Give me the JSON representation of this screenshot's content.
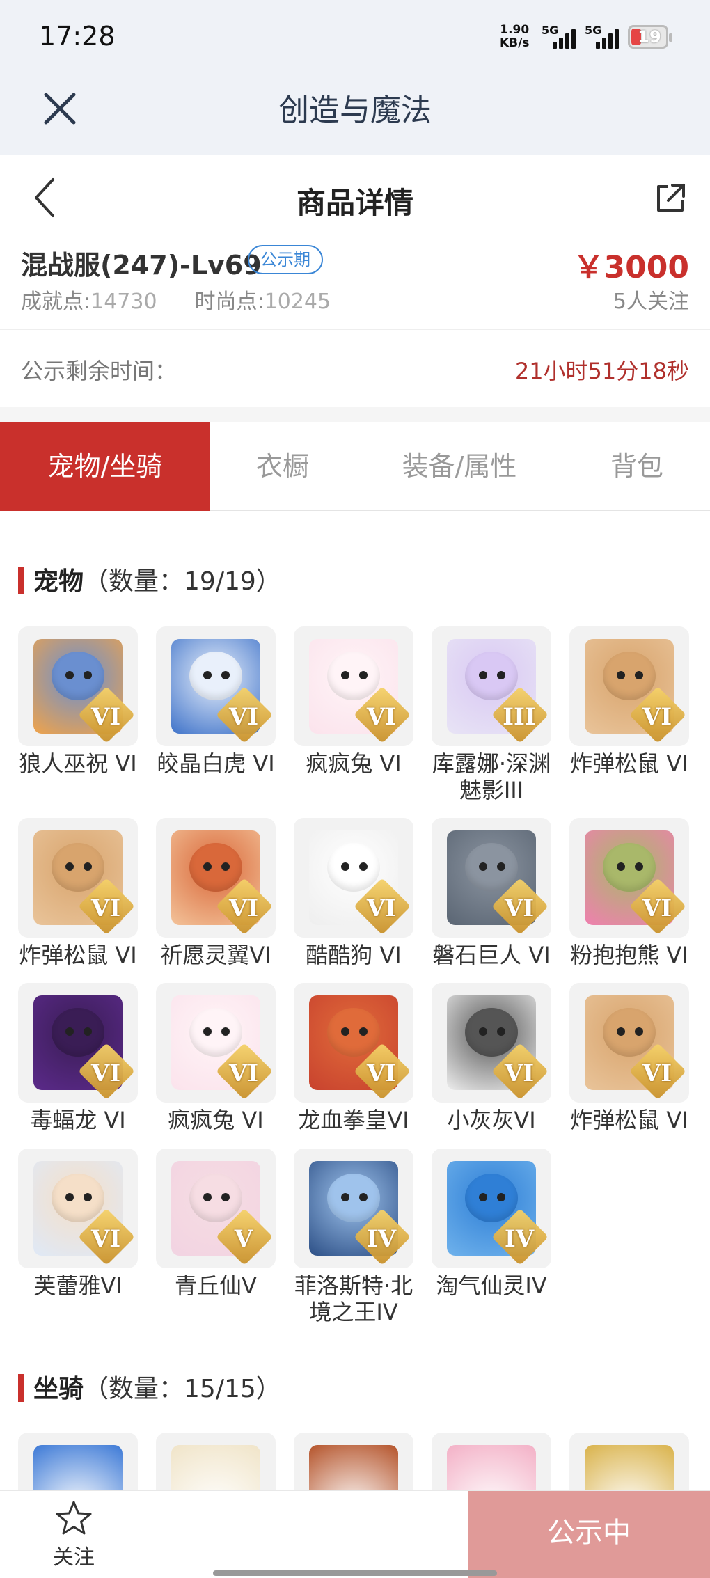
{
  "status": {
    "time": "17:28",
    "net_speed_value": "1.90",
    "net_speed_unit": "KB/s",
    "sim1": "5G",
    "sim2": "5G",
    "battery": "19"
  },
  "appbar": {
    "title": "创造与魔法"
  },
  "page": {
    "title": "商品详情"
  },
  "listing": {
    "name": "混战服(247)-Lv69",
    "badge": "公示期",
    "price": "￥3000",
    "achievement_label": "成就点:",
    "achievement_value": "14730",
    "fashion_label": "时尚点:",
    "fashion_value": "10245",
    "followers": "5人关注"
  },
  "countdown": {
    "label": "公示剩余时间：",
    "value": "21小时51分18秒"
  },
  "tabs": [
    {
      "label": "宠物/坐骑",
      "active": true
    },
    {
      "label": "衣橱",
      "active": false
    },
    {
      "label": "装备/属性",
      "active": false
    },
    {
      "label": "背包",
      "active": false
    }
  ],
  "pets": {
    "title": "宠物",
    "count": "（数量：19/19）",
    "items": [
      {
        "name": "狼人巫祝 VI",
        "grade": "VI",
        "bg": "#f0a34a",
        "head": "#6a8fd0"
      },
      {
        "name": "皎晶白虎 VI",
        "grade": "VI",
        "bg": "#3f73c9",
        "head": "#e9f0fb"
      },
      {
        "name": "疯疯兔 VI",
        "grade": "VI",
        "bg": "#fbe3ec",
        "head": "#fff4f7"
      },
      {
        "name": "库露娜·深渊魅影III",
        "grade": "III",
        "bg": "#e8e4f5",
        "head": "#d9c8f4"
      },
      {
        "name": "炸弹松鼠 VI",
        "grade": "VI",
        "bg": "#e9c49a",
        "head": "#d8a46d"
      },
      {
        "name": "炸弹松鼠 VI",
        "grade": "VI",
        "bg": "#e9c49a",
        "head": "#d8a46d"
      },
      {
        "name": "祈愿灵翼VI",
        "grade": "VI",
        "bg": "#f3c39a",
        "head": "#d9683a"
      },
      {
        "name": "酷酷狗 VI",
        "grade": "VI",
        "bg": "#eeeeee",
        "head": "#ffffff"
      },
      {
        "name": "磐石巨人 VI",
        "grade": "VI",
        "bg": "#5a6573",
        "head": "#8b94a0"
      },
      {
        "name": "粉抱抱熊 VI",
        "grade": "VI",
        "bg": "#f07fb0",
        "head": "#a9b86a"
      },
      {
        "name": "毒蝠龙 VI",
        "grade": "VI",
        "bg": "#5b2a8a",
        "head": "#3a1d55"
      },
      {
        "name": "疯疯兔 VI",
        "grade": "VI",
        "bg": "#fbe3ec",
        "head": "#fff4f7"
      },
      {
        "name": "龙血拳皇VI",
        "grade": "VI",
        "bg": "#c8422e",
        "head": "#e06b3a"
      },
      {
        "name": "小灰灰VI",
        "grade": "VI",
        "bg": "#eeeeee",
        "head": "#555555"
      },
      {
        "name": "炸弹松鼠 VI",
        "grade": "VI",
        "bg": "#e9c49a",
        "head": "#d8a46d"
      },
      {
        "name": "芙蕾雅VI",
        "grade": "VI",
        "bg": "#dfe9f7",
        "head": "#f5dfc8"
      },
      {
        "name": "青丘仙V",
        "grade": "V",
        "bg": "#f2d3e2",
        "head": "#f6dde3"
      },
      {
        "name": "菲洛斯特·北境之王IV",
        "grade": "IV",
        "bg": "#2c4f86",
        "head": "#9fc3ec"
      },
      {
        "name": "淘气仙灵IV",
        "grade": "IV",
        "bg": "#6fb2ec",
        "head": "#2f7fd6"
      }
    ]
  },
  "mounts": {
    "title": "坐骑",
    "count": "（数量：15/15）",
    "items": [
      {
        "bg": "#3c79d6"
      },
      {
        "bg": "#f0e4c8"
      },
      {
        "bg": "#b4532a"
      },
      {
        "bg": "#f3b0c6"
      },
      {
        "bg": "#d9b24a"
      }
    ]
  },
  "bottom": {
    "follow_label": "关注",
    "cta_label": "公示中"
  },
  "colors": {
    "accent": "#c9302c",
    "badge": "#3a86d6",
    "cta": "#e09a98"
  }
}
